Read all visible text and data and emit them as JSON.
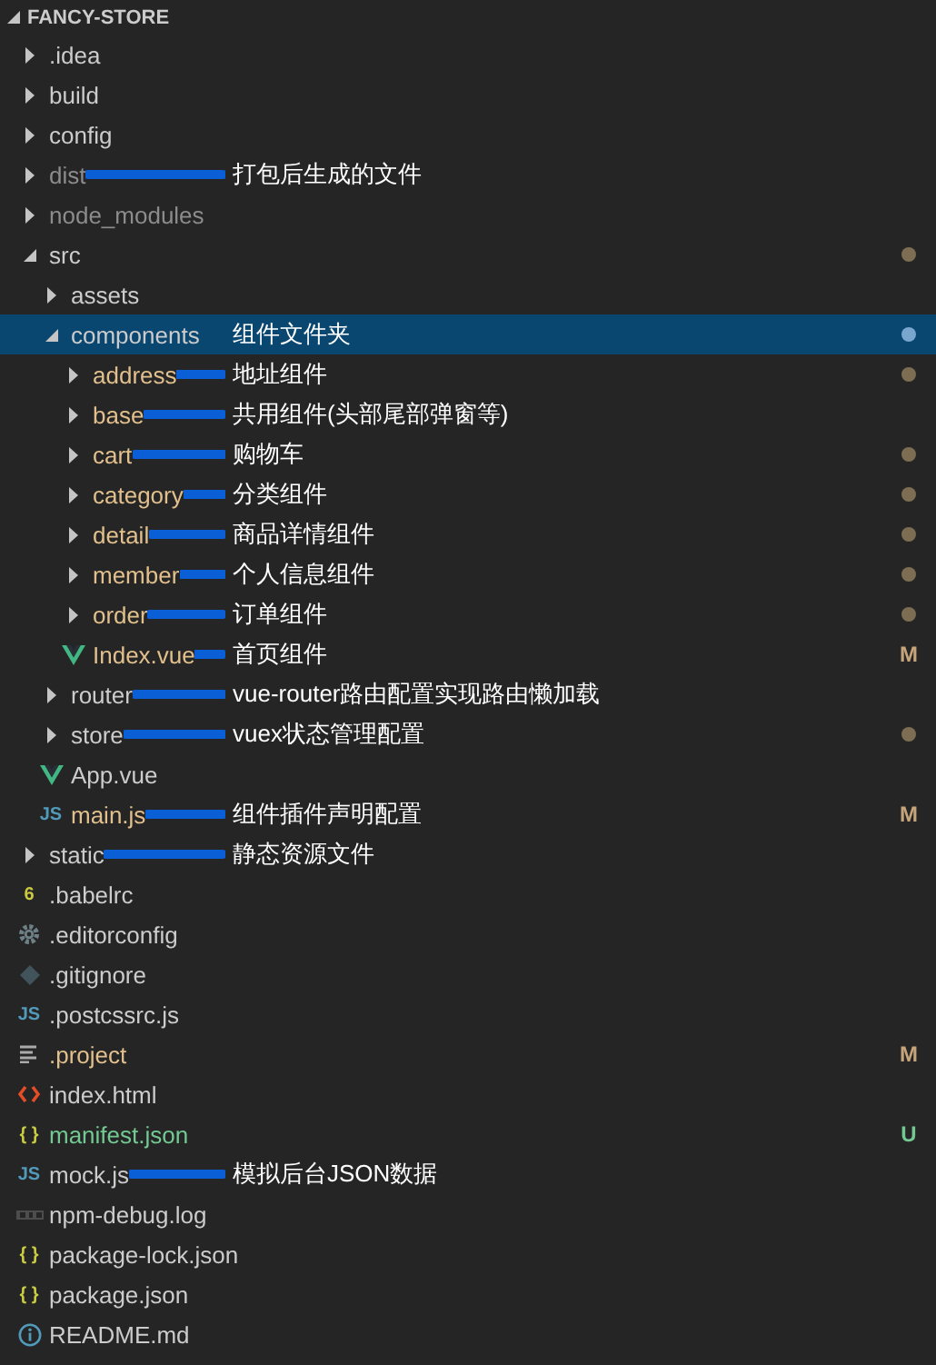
{
  "explorer": {
    "title": "FANCY-STORE",
    "expanded": true,
    "items": [
      {
        "name": ".idea",
        "kind": "folder",
        "expanded": false,
        "selected": false
      },
      {
        "name": "build",
        "kind": "folder",
        "expanded": false,
        "selected": false
      },
      {
        "name": "config",
        "kind": "folder",
        "expanded": false,
        "selected": false
      },
      {
        "name": "dist",
        "kind": "folder",
        "expanded": false,
        "selected": false,
        "color": "#8c8c8c",
        "note": {
          "text": "打包后生成的文件",
          "stroke": true
        }
      },
      {
        "name": "node_modules",
        "kind": "folder",
        "expanded": false,
        "selected": false,
        "color": "#8c8c8c"
      },
      {
        "name": "src",
        "kind": "folder",
        "expanded": true,
        "selected": false,
        "dot": true,
        "children": [
          {
            "name": "assets",
            "kind": "folder",
            "expanded": false,
            "selected": false
          },
          {
            "name": "components",
            "kind": "folder",
            "expanded": true,
            "selected": true,
            "dot": true,
            "note": {
              "text": "组件文件夹",
              "stroke": false
            },
            "children": [
              {
                "name": "address",
                "kind": "folder",
                "expanded": false,
                "selected": false,
                "color": "#e2c08d",
                "dot": true,
                "note": {
                  "text": "地址组件",
                  "stroke": true
                }
              },
              {
                "name": "base",
                "kind": "folder",
                "expanded": false,
                "selected": false,
                "color": "#e2c08d",
                "note": {
                  "text": "共用组件(头部尾部弹窗等)",
                  "stroke": true
                }
              },
              {
                "name": "cart",
                "kind": "folder",
                "expanded": false,
                "selected": false,
                "color": "#e2c08d",
                "dot": true,
                "note": {
                  "text": "购物车",
                  "stroke": true
                }
              },
              {
                "name": "category",
                "kind": "folder",
                "expanded": false,
                "selected": false,
                "color": "#e2c08d",
                "dot": true,
                "note": {
                  "text": "分类组件",
                  "stroke": true
                }
              },
              {
                "name": "detail",
                "kind": "folder",
                "expanded": false,
                "selected": false,
                "color": "#e2c08d",
                "dot": true,
                "note": {
                  "text": "商品详情组件",
                  "stroke": true
                }
              },
              {
                "name": "member",
                "kind": "folder",
                "expanded": false,
                "selected": false,
                "color": "#e2c08d",
                "dot": true,
                "note": {
                  "text": "个人信息组件",
                  "stroke": true
                }
              },
              {
                "name": "order",
                "kind": "folder",
                "expanded": false,
                "selected": false,
                "color": "#e2c08d",
                "dot": true,
                "note": {
                  "text": "订单组件",
                  "stroke": true
                }
              },
              {
                "name": "Index.vue",
                "kind": "vue",
                "selected": false,
                "color": "#e2c08d",
                "badge": "M",
                "note": {
                  "text": "首页组件",
                  "stroke": true
                }
              }
            ]
          },
          {
            "name": "router",
            "kind": "folder",
            "expanded": false,
            "selected": false,
            "note": {
              "text": "vue-router路由配置实现路由懒加载",
              "stroke": true
            }
          },
          {
            "name": "store",
            "kind": "folder",
            "expanded": false,
            "selected": false,
            "dot": true,
            "note": {
              "text": "vuex状态管理配置",
              "stroke": true
            }
          },
          {
            "name": "App.vue",
            "kind": "vue",
            "selected": false
          },
          {
            "name": "main.js",
            "kind": "js",
            "glyph": "JS",
            "selected": false,
            "color": "#e2c08d",
            "badge": "M",
            "note": {
              "text": "组件插件声明配置",
              "stroke": true
            }
          }
        ]
      },
      {
        "name": "static",
        "kind": "folder",
        "expanded": false,
        "selected": false,
        "note": {
          "text": "静态资源文件",
          "stroke": true
        }
      },
      {
        "name": ".babelrc",
        "kind": "babel",
        "glyph": "6",
        "selected": false
      },
      {
        "name": ".editorconfig",
        "kind": "gear",
        "selected": false
      },
      {
        "name": ".gitignore",
        "kind": "git",
        "selected": false
      },
      {
        "name": ".postcssrc.js",
        "kind": "js",
        "glyph": "JS",
        "selected": false
      },
      {
        "name": ".project",
        "kind": "lines",
        "selected": false,
        "color": "#e2c08d",
        "badge": "M"
      },
      {
        "name": "index.html",
        "kind": "html",
        "selected": false
      },
      {
        "name": "manifest.json",
        "kind": "json",
        "glyph": "{ }",
        "selected": false,
        "color": "#73c991",
        "badge": "U"
      },
      {
        "name": "mock.js",
        "kind": "js",
        "glyph": "JS",
        "selected": false,
        "note": {
          "text": "模拟后台JSON数据",
          "stroke": true
        }
      },
      {
        "name": "npm-debug.log",
        "kind": "npm",
        "selected": false
      },
      {
        "name": "package-lock.json",
        "kind": "json",
        "glyph": "{ }",
        "selected": false
      },
      {
        "name": "package.json",
        "kind": "json",
        "glyph": "{ }",
        "selected": false
      },
      {
        "name": "README.md",
        "kind": "info",
        "selected": false
      }
    ]
  }
}
